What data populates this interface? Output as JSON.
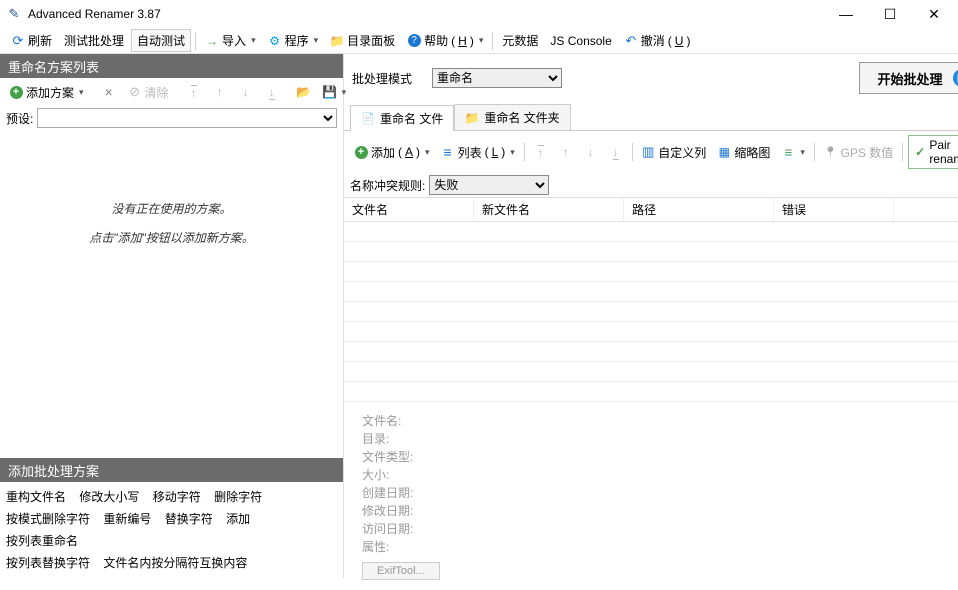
{
  "title": "Advanced Renamer 3.87",
  "toolbar": {
    "refresh": "刷新",
    "test_batch": "测试批处理",
    "auto_test": "自动测试",
    "import": "导入",
    "program": "程序",
    "folder_panel": "目录面板",
    "help": "帮助",
    "help_key": "H",
    "metadata": "元数据",
    "js_console": "JS Console",
    "undo": "撤消",
    "undo_key": "U"
  },
  "left": {
    "header": "重命名方案列表",
    "add_method": "添加方案",
    "clear": "清除",
    "preset_label": "预设:",
    "empty_line1": "没有正在使用的方案。",
    "empty_line2": "点击\"添加\"按钮以添加新方案。",
    "bottom_header": "添加批处理方案",
    "methods": {
      "r1": [
        "重构文件名",
        "修改大小写",
        "移动字符",
        "删除字符"
      ],
      "r2": [
        "按模式删除字符",
        "重新编号",
        "替换字符",
        "添加",
        "按列表重命名"
      ],
      "r3": [
        "按列表替换字符",
        "文件名内按分隔符互换内容"
      ]
    }
  },
  "right": {
    "mode_label": "批处理模式",
    "mode_value": "重命名",
    "start_label": "开始批处理",
    "tab_files": "重命名 文件",
    "tab_folders": "重命名 文件夹",
    "file_toolbar": {
      "add": "添加",
      "add_key": "A",
      "list": "列表",
      "list_key": "L",
      "custom_cols": "自定义列",
      "thumbs": "缩略图",
      "gps": "GPS 数值",
      "pair": "Pair renaming"
    },
    "conflict_label": "名称冲突规则:",
    "conflict_value": "失败",
    "columns": {
      "name": "文件名",
      "newname": "新文件名",
      "path": "路径",
      "error": "错误"
    },
    "info": {
      "filename": "文件名:",
      "dir": "目录:",
      "type": "文件类型:",
      "size": "大小:",
      "created": "创建日期:",
      "modified": "修改日期:",
      "accessed": "访问日期:",
      "attrs": "属性:",
      "exif": "ExifTool..."
    }
  }
}
